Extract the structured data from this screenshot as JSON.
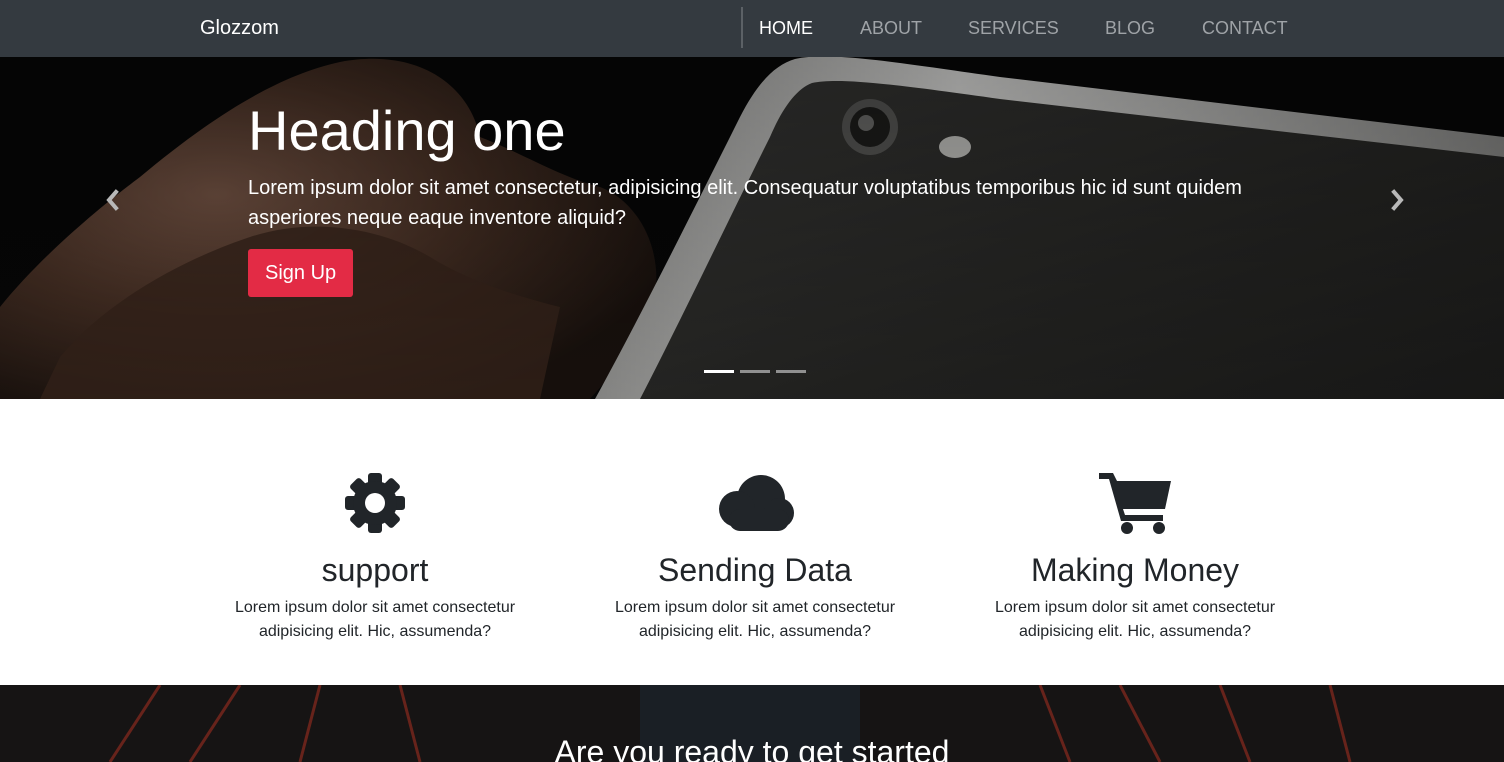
{
  "navbar": {
    "brand": "Glozzom",
    "links": [
      {
        "label": "HOME",
        "active": true
      },
      {
        "label": "ABOUT",
        "active": false
      },
      {
        "label": "SERVICES",
        "active": false
      },
      {
        "label": "BLOG",
        "active": false
      },
      {
        "label": "CONTACT",
        "active": false
      }
    ]
  },
  "hero": {
    "title": "Heading one",
    "text": "Lorem ipsum dolor sit amet consectetur, adipisicing elit. Consequatur voluptatibus temporibus hic id sunt quidem asperiores neque eaque inventore aliquid?",
    "button_label": "Sign Up",
    "prev_icon": "chevron-left-icon",
    "next_icon": "chevron-right-icon",
    "slide_count": 3,
    "active_slide": 1
  },
  "features": [
    {
      "icon": "gear-icon",
      "title": "support",
      "text": "Lorem ipsum dolor sit amet consectetur adipisicing elit. Hic, assumenda?"
    },
    {
      "icon": "cloud-icon",
      "title": "Sending Data",
      "text": "Lorem ipsum dolor sit amet consectetur adipisicing elit. Hic, assumenda?"
    },
    {
      "icon": "shopping-cart-icon",
      "title": "Making Money",
      "text": "Lorem ipsum dolor sit amet consectetur adipisicing elit. Hic, assumenda?"
    }
  ],
  "cta": {
    "title": "Are you ready to get started"
  },
  "colors": {
    "navbar_bg": "#343a40",
    "accent": "#e32b45",
    "text_dark": "#212529"
  }
}
